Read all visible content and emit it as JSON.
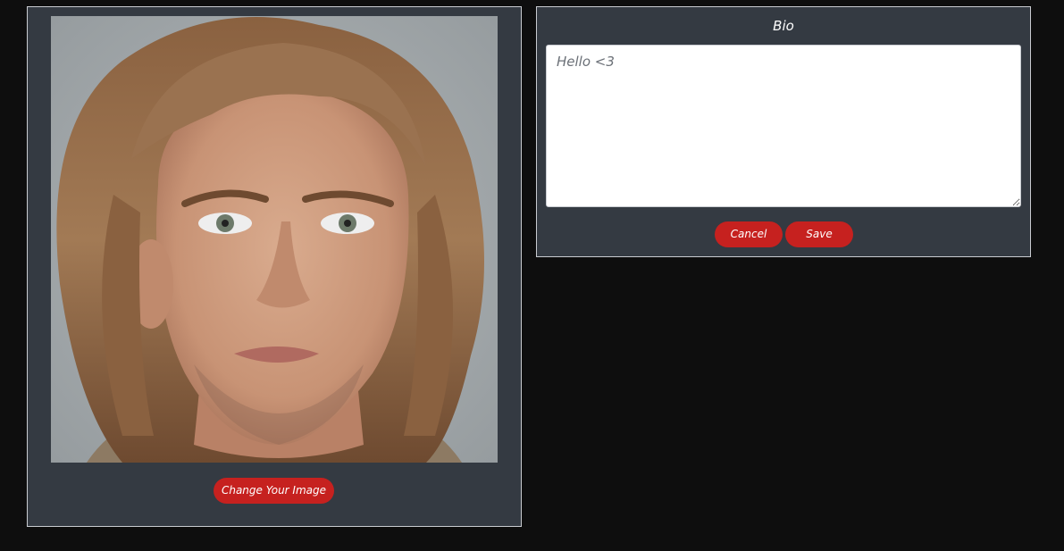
{
  "profile_image": {
    "alt": "Profile picture",
    "change_button_label": "Change Your Image"
  },
  "bio": {
    "title": "Bio",
    "placeholder": "Hello <3",
    "value": "",
    "cancel_label": "Cancel",
    "save_label": "Save"
  },
  "colors": {
    "background": "#0e0e0e",
    "panel": "#343a42",
    "accent_red": "#c6211f",
    "panel_border": "#c9ccd1"
  }
}
